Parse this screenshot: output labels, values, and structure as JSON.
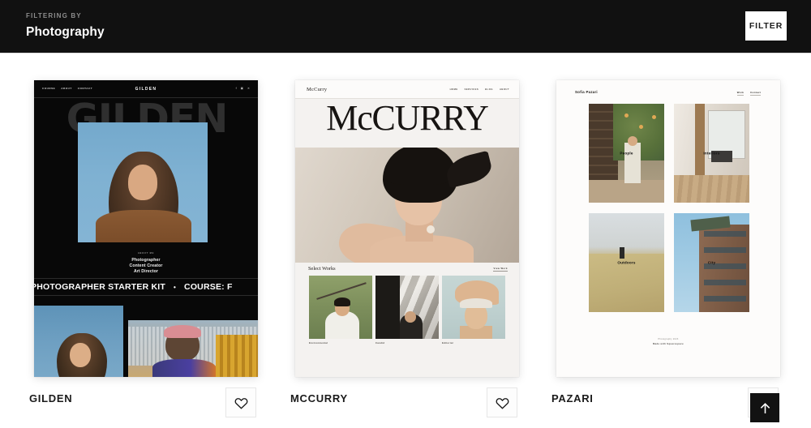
{
  "header": {
    "eyebrow": "FILTERING BY",
    "title": "Photography",
    "filter_button_label": "FILTER"
  },
  "colors": {
    "header_bg": "#111111",
    "page_bg": "#ffffff",
    "accent_dark": "#121212",
    "divider": "#dcdcdc"
  },
  "cards": [
    {
      "id": "gilden",
      "title": "GILDEN",
      "like_icon": "heart-icon",
      "preview": {
        "theme": "dark",
        "nav_links": [
          "COURSE",
          "ABOUT",
          "CONTACT"
        ],
        "logo": "GILDEN",
        "social_icons": [
          "facebook-icon",
          "instagram-icon",
          "twitter-icon"
        ],
        "wordmark": "GILDEN",
        "about_kicker": "ABOUT ME",
        "about_lines": [
          "Photographer",
          "Content Creator",
          "Art Director"
        ],
        "marquee": "PHOTOGRAPHER STARTER KIT",
        "marquee_separator": "•",
        "marquee_second": "COURSE: F"
      }
    },
    {
      "id": "mccurry",
      "title": "MCCURRY",
      "like_icon": "heart-icon",
      "preview": {
        "theme": "light",
        "logo": "McCurry",
        "nav_links": [
          "HOME",
          "SERVICES",
          "BLOG",
          "ABOUT"
        ],
        "wordmark": "McCURRY",
        "works_title": "Select Works",
        "works_link": "View Work",
        "thumbs": [
          {
            "caption": "Environmental"
          },
          {
            "caption": "Candid"
          },
          {
            "caption": "Editorial"
          }
        ]
      }
    },
    {
      "id": "pazari",
      "title": "PAZARI",
      "like_icon": "heart-icon",
      "preview": {
        "theme": "light",
        "logo": "Sofia Pazari",
        "nav_links": [
          "Work",
          "Contact"
        ],
        "tiles": [
          {
            "label": "People"
          },
          {
            "label": "Interiors"
          },
          {
            "label": "Outdoors"
          },
          {
            "label": "City"
          }
        ],
        "footer_line1": "Photography 2023",
        "footer_line2": "Made with Squarespace"
      }
    }
  ],
  "back_to_top": {
    "icon": "arrow-up-icon",
    "label": "Back to top"
  }
}
